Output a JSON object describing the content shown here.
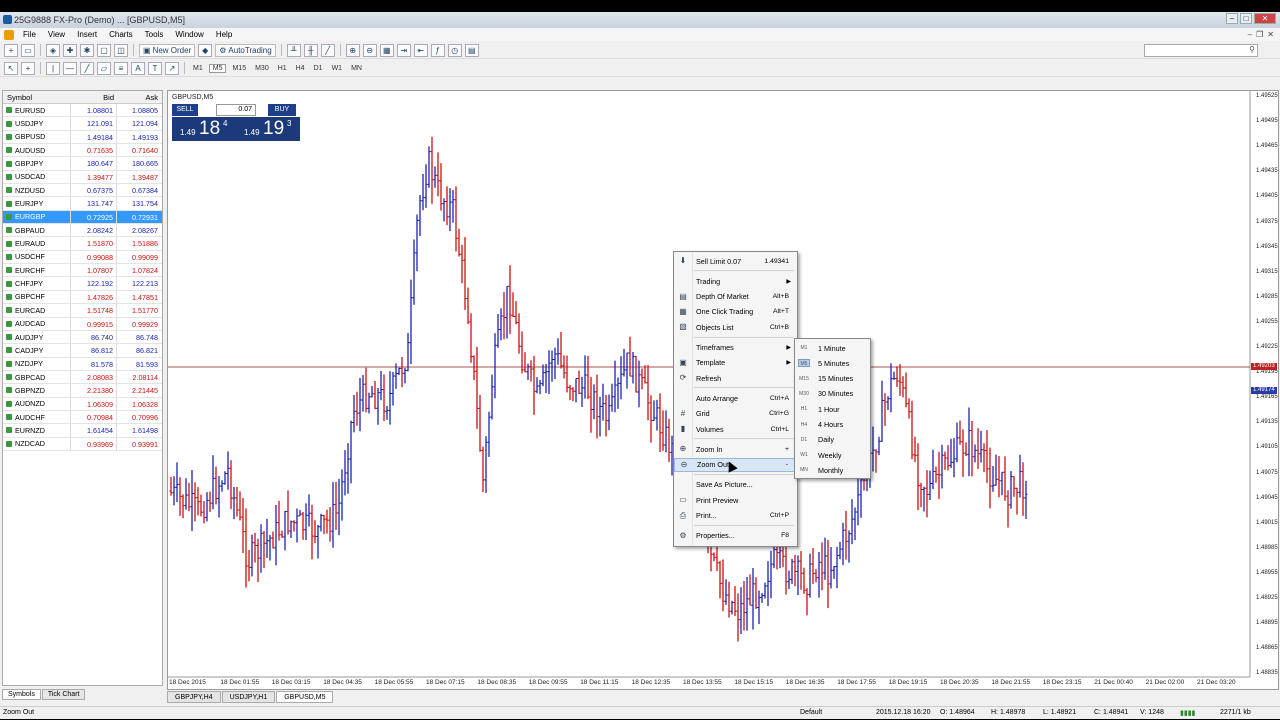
{
  "window": {
    "title": "25G9888 FX-Pro (Demo) ... [GBPUSD,M5]"
  },
  "menu": [
    "File",
    "View",
    "Insert",
    "Charts",
    "Tools",
    "Window",
    "Help"
  ],
  "toolbar": {
    "new_order": "New Order",
    "autotrading": "AutoTrading",
    "timeframes": [
      "M1",
      "M5",
      "M15",
      "M30",
      "H1",
      "H4",
      "D1",
      "W1",
      "MN"
    ]
  },
  "market_watch": {
    "headers": {
      "symbol": "Symbol",
      "bid": "Bid",
      "ask": "Ask"
    },
    "rows": [
      {
        "symbol": "EURUSD",
        "bid": "1.08801",
        "ask": "1.08805",
        "dir": "up"
      },
      {
        "symbol": "USDJPY",
        "bid": "121.091",
        "ask": "121.094",
        "dir": "up"
      },
      {
        "symbol": "GBPUSD",
        "bid": "1.49184",
        "ask": "1.49193",
        "dir": "up"
      },
      {
        "symbol": "AUDUSD",
        "bid": "0.71635",
        "ask": "0.71640",
        "dir": "down"
      },
      {
        "symbol": "GBPJPY",
        "bid": "180.647",
        "ask": "180.665",
        "dir": "up"
      },
      {
        "symbol": "USDCAD",
        "bid": "1.39477",
        "ask": "1.39487",
        "dir": "down"
      },
      {
        "symbol": "NZDUSD",
        "bid": "0.67375",
        "ask": "0.67384",
        "dir": "up"
      },
      {
        "symbol": "EURJPY",
        "bid": "131.747",
        "ask": "131.754",
        "dir": "up"
      },
      {
        "symbol": "EURGBP",
        "bid": "0.72925",
        "ask": "0.72931",
        "dir": "up"
      },
      {
        "symbol": "GBPAUD",
        "bid": "2.08242",
        "ask": "2.08267",
        "dir": "up"
      },
      {
        "symbol": "EURAUD",
        "bid": "1.51870",
        "ask": "1.51886",
        "dir": "down"
      },
      {
        "symbol": "USDCHF",
        "bid": "0.99088",
        "ask": "0.99099",
        "dir": "down"
      },
      {
        "symbol": "EURCHF",
        "bid": "1.07807",
        "ask": "1.07824",
        "dir": "down"
      },
      {
        "symbol": "CHFJPY",
        "bid": "122.192",
        "ask": "122.213",
        "dir": "up"
      },
      {
        "symbol": "GBPCHF",
        "bid": "1.47826",
        "ask": "1.47851",
        "dir": "down"
      },
      {
        "symbol": "EURCAD",
        "bid": "1.51748",
        "ask": "1.51770",
        "dir": "down"
      },
      {
        "symbol": "AUDCAD",
        "bid": "0.99915",
        "ask": "0.99929",
        "dir": "down"
      },
      {
        "symbol": "AUDJPY",
        "bid": "86.740",
        "ask": "86.748",
        "dir": "up"
      },
      {
        "symbol": "CADJPY",
        "bid": "86.812",
        "ask": "86.821",
        "dir": "up"
      },
      {
        "symbol": "NZDJPY",
        "bid": "81.578",
        "ask": "81.593",
        "dir": "up"
      },
      {
        "symbol": "GBPCAD",
        "bid": "2.08083",
        "ask": "2.08114",
        "dir": "down"
      },
      {
        "symbol": "GBPNZD",
        "bid": "2.21380",
        "ask": "2.21445",
        "dir": "down"
      },
      {
        "symbol": "AUDNZD",
        "bid": "1.06309",
        "ask": "1.06328",
        "dir": "down"
      },
      {
        "symbol": "AUDCHF",
        "bid": "0.70984",
        "ask": "0.70996",
        "dir": "down"
      },
      {
        "symbol": "EURNZD",
        "bid": "1.61454",
        "ask": "1.61498",
        "dir": "up"
      },
      {
        "symbol": "NZDCAD",
        "bid": "0.93969",
        "ask": "0.93991",
        "dir": "down"
      }
    ],
    "selected_index": 8,
    "tabs": [
      "Symbols",
      "Tick Chart"
    ]
  },
  "chart": {
    "label": "GBPUSD,M5",
    "one_click": {
      "sell": "SELL",
      "buy": "BUY",
      "volume": "0.07",
      "sell_prefix": "1.49",
      "sell_big": "18",
      "sell_sup": "4",
      "buy_prefix": "1.49",
      "buy_big": "19",
      "buy_sup": "3"
    },
    "x_labels": [
      "18 Dec 2015",
      "18 Dec 01:55",
      "18 Dec 03:15",
      "18 Dec 04:35",
      "18 Dec 05:55",
      "18 Dec 07:15",
      "18 Dec 08:35",
      "18 Dec 09:55",
      "18 Dec 11:15",
      "18 Dec 12:35",
      "18 Dec 13:55",
      "18 Dec 15:15",
      "18 Dec 16:35",
      "18 Dec 17:55",
      "18 Dec 19:15",
      "18 Dec 20:35",
      "18 Dec 21:55",
      "18 Dec 23:15",
      "21 Dec 00:40",
      "21 Dec 02:00",
      "21 Dec 03:20"
    ],
    "y_labels": [
      "1.49525",
      "1.49495",
      "1.49465",
      "1.49435",
      "1.49405",
      "1.49375",
      "1.49345",
      "1.49315",
      "1.49285",
      "1.49255",
      "1.49225",
      "1.49195",
      "1.49165",
      "1.49135",
      "1.49105",
      "1.49075",
      "1.49045",
      "1.49015",
      "1.48985",
      "1.48955",
      "1.48925",
      "1.48895",
      "1.48865",
      "1.48835"
    ],
    "price_tags": {
      "sell_limit": "1.49341",
      "ask": "1.49203",
      "bid": "1.49174"
    },
    "colors": {
      "bull": "#1a23b0",
      "bear": "#cc1111",
      "limit_line": "#8b1a1a"
    }
  },
  "context_menu": {
    "items": [
      {
        "label": "Sell Limit 0.07",
        "shortcut": "1.49341",
        "icon": "sell-limit-icon",
        "glyph": "⬇"
      },
      {
        "label": "Trading",
        "submenu": true,
        "icon": "",
        "glyph": ""
      },
      {
        "label": "Depth Of Market",
        "shortcut": "Alt+B",
        "icon": "depth-of-market-icon",
        "glyph": "▤"
      },
      {
        "label": "One Click Trading",
        "shortcut": "Alt+T",
        "icon": "one-click-icon",
        "glyph": "▦"
      },
      {
        "label": "Objects List",
        "shortcut": "Ctrl+B",
        "icon": "objects-list-icon",
        "glyph": "▧"
      },
      {
        "label": "Timeframes",
        "submenu": true,
        "icon": "",
        "glyph": ""
      },
      {
        "label": "Template",
        "submenu": true,
        "icon": "template-icon",
        "glyph": "▣"
      },
      {
        "label": "Refresh",
        "icon": "refresh-icon",
        "glyph": "⟳"
      },
      {
        "label": "Auto Arrange",
        "shortcut": "Ctrl+A",
        "icon": "",
        "glyph": ""
      },
      {
        "label": "Grid",
        "shortcut": "Ctrl+G",
        "icon": "grid-icon",
        "glyph": "#"
      },
      {
        "label": "Volumes",
        "shortcut": "Ctrl+L",
        "icon": "volumes-icon",
        "glyph": "▮"
      },
      {
        "label": "Zoom In",
        "shortcut": "+",
        "icon": "zoom-in-icon",
        "glyph": "⊕"
      },
      {
        "label": "Zoom Out",
        "shortcut": "-",
        "icon": "zoom-out-icon",
        "glyph": "⊖"
      },
      {
        "label": "Save As Picture...",
        "icon": "",
        "glyph": ""
      },
      {
        "label": "Print Preview",
        "icon": "print-preview-icon",
        "glyph": "▭"
      },
      {
        "label": "Print...",
        "shortcut": "Ctrl+P",
        "icon": "print-icon",
        "glyph": "⎙"
      },
      {
        "label": "Properties...",
        "shortcut": "F8",
        "icon": "properties-icon",
        "glyph": "⚙"
      }
    ],
    "highlighted": "Zoom Out"
  },
  "timeframes_submenu": {
    "items": [
      {
        "code": "M1",
        "label": "1 Minute"
      },
      {
        "code": "M5",
        "label": "5 Minutes"
      },
      {
        "code": "M15",
        "label": "15 Minutes"
      },
      {
        "code": "M30",
        "label": "30 Minutes"
      },
      {
        "code": "H1",
        "label": "1 Hour"
      },
      {
        "code": "H4",
        "label": "4 Hours"
      },
      {
        "code": "D1",
        "label": "Daily"
      },
      {
        "code": "W1",
        "label": "Weekly"
      },
      {
        "code": "MN",
        "label": "Monthly"
      }
    ],
    "current": "M5"
  },
  "chart_tabs": [
    "GBPJPY,H4",
    "USDJPY,H1",
    "GBPUSD,M5"
  ],
  "active_chart_tab": 2,
  "status": {
    "hint": "Zoom Out",
    "profile": "Default",
    "datetime": "2015.12.18 16:20",
    "open": "O: 1.48964",
    "high": "H: 1.48978",
    "low": "L: 1.48921",
    "close": "C: 1.48941",
    "volume": "V: 1248",
    "traffic": "2271/1 kb"
  }
}
